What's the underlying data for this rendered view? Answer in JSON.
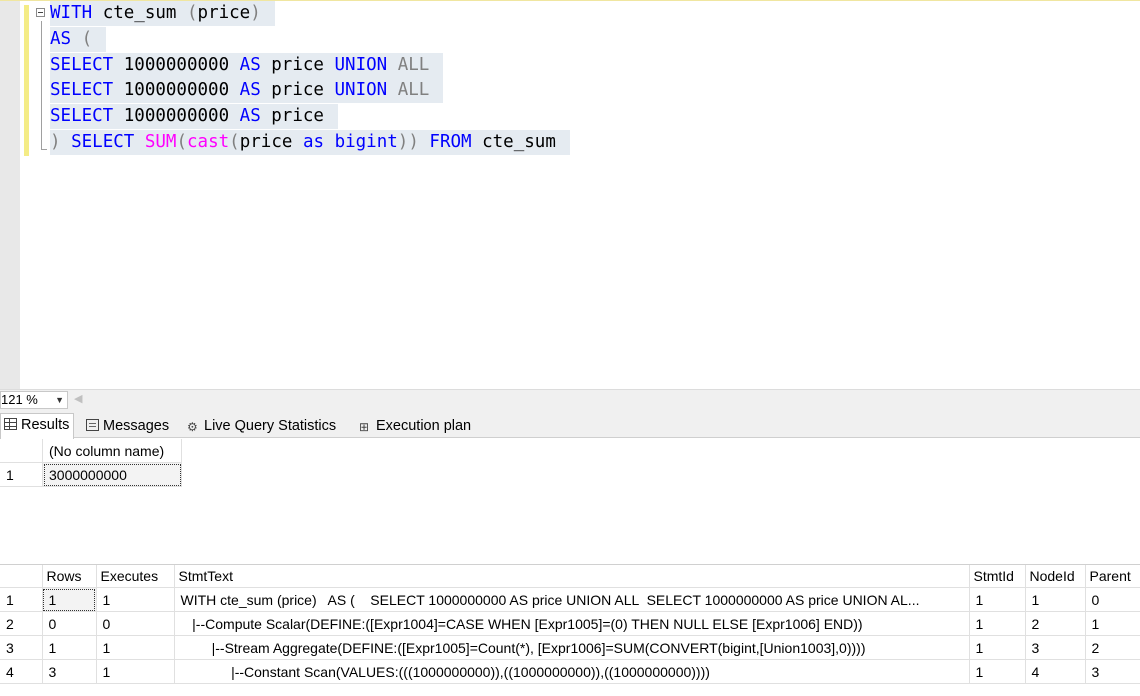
{
  "editor": {
    "lines": [
      [
        {
          "t": "WITH",
          "c": "kw"
        },
        {
          "t": " cte_sum ",
          "c": ""
        },
        {
          "t": "(",
          "c": "gray"
        },
        {
          "t": "price",
          "c": ""
        },
        {
          "t": ")",
          "c": "gray"
        }
      ],
      [
        {
          "t": "AS",
          "c": "kw"
        },
        {
          "t": " (",
          "c": "gray"
        }
      ],
      [
        {
          "t": "SELECT",
          "c": "kw"
        },
        {
          "t": " 1000000000 ",
          "c": ""
        },
        {
          "t": "AS",
          "c": "kw"
        },
        {
          "t": " price ",
          "c": ""
        },
        {
          "t": "UNION",
          "c": "kw"
        },
        {
          "t": " ALL",
          "c": "gray"
        }
      ],
      [
        {
          "t": "SELECT",
          "c": "kw"
        },
        {
          "t": " 1000000000 ",
          "c": ""
        },
        {
          "t": "AS",
          "c": "kw"
        },
        {
          "t": " price ",
          "c": ""
        },
        {
          "t": "UNION",
          "c": "kw"
        },
        {
          "t": " ALL",
          "c": "gray"
        }
      ],
      [
        {
          "t": "SELECT",
          "c": "kw"
        },
        {
          "t": " 1000000000 ",
          "c": ""
        },
        {
          "t": "AS",
          "c": "kw"
        },
        {
          "t": " price",
          "c": ""
        }
      ],
      [
        {
          "t": ")",
          "c": "gray"
        },
        {
          "t": " ",
          "c": ""
        },
        {
          "t": "SELECT",
          "c": "kw"
        },
        {
          "t": " ",
          "c": ""
        },
        {
          "t": "SUM",
          "c": "fn"
        },
        {
          "t": "(",
          "c": "gray"
        },
        {
          "t": "cast",
          "c": "fn"
        },
        {
          "t": "(",
          "c": "gray"
        },
        {
          "t": "price ",
          "c": ""
        },
        {
          "t": "as",
          "c": "kw"
        },
        {
          "t": " ",
          "c": ""
        },
        {
          "t": "bigint",
          "c": "kw"
        },
        {
          "t": "))",
          "c": "gray"
        },
        {
          "t": " ",
          "c": ""
        },
        {
          "t": "FROM",
          "c": "kw"
        },
        {
          "t": " cte_sum",
          "c": ""
        }
      ]
    ]
  },
  "zoom": {
    "value": "121 %"
  },
  "tabs": [
    {
      "label": "Results",
      "icon": "grid-icon"
    },
    {
      "label": "Messages",
      "icon": "messages-icon"
    },
    {
      "label": "Live Query Statistics",
      "icon": "live-stats-icon"
    },
    {
      "label": "Execution plan",
      "icon": "execution-plan-icon"
    }
  ],
  "results": {
    "columns": [
      "(No column name)"
    ],
    "rows": [
      [
        "1",
        "3000000000"
      ]
    ]
  },
  "stats": {
    "columns": [
      "Rows",
      "Executes",
      "StmtText",
      "StmtId",
      "NodeId",
      "Parent"
    ],
    "rows": [
      [
        "1",
        "1",
        "1",
        "WITH cte_sum (price)   AS (    SELECT 1000000000 AS price UNION ALL  SELECT 1000000000 AS price UNION AL...",
        "1",
        "1",
        "0"
      ],
      [
        "2",
        "0",
        "0",
        "   |--Compute Scalar(DEFINE:([Expr1004]=CASE WHEN [Expr1005]=(0) THEN NULL ELSE [Expr1006] END))",
        "1",
        "2",
        "1"
      ],
      [
        "3",
        "1",
        "1",
        "        |--Stream Aggregate(DEFINE:([Expr1005]=Count(*), [Expr1006]=SUM(CONVERT(bigint,[Union1003],0))))",
        "1",
        "3",
        "2"
      ],
      [
        "4",
        "3",
        "1",
        "             |--Constant Scan(VALUES:(((1000000000)),((1000000000)),((1000000000))))",
        "1",
        "4",
        "3"
      ]
    ]
  }
}
